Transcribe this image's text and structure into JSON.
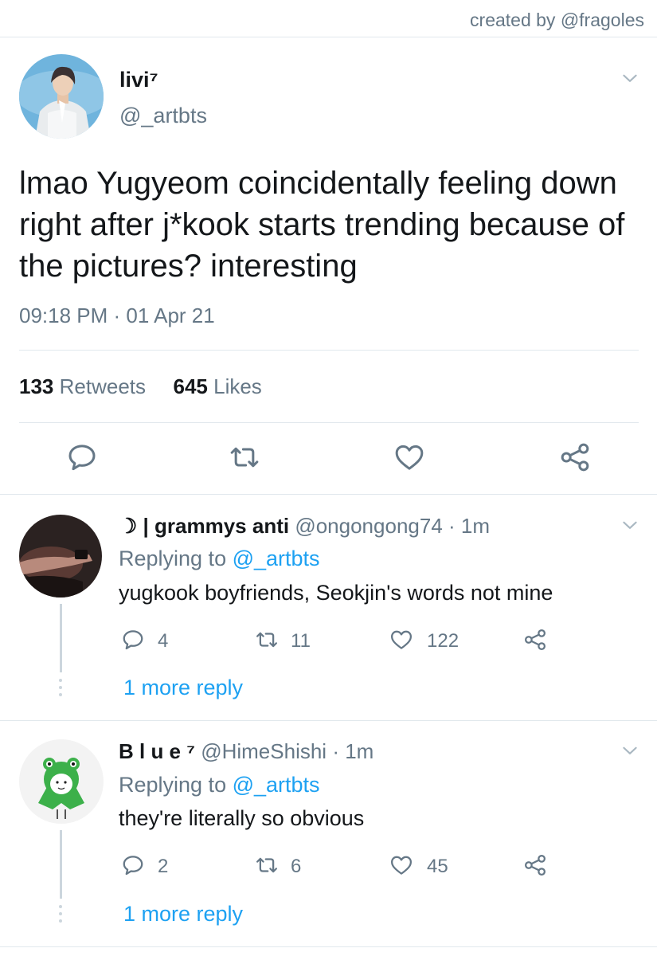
{
  "credit": "created by @fragoles",
  "main": {
    "name": "livi⁷",
    "handle": "@_artbts",
    "text": "lmao Yugyeom coincidentally feeling down right after j*kook starts trending because of the pictures? interesting",
    "timestamp": "09:18 PM · 01 Apr 21",
    "retweets_count": "133",
    "retweets_label": "Retweets",
    "likes_count": "645",
    "likes_label": "Likes"
  },
  "replies": [
    {
      "name": "☽ | grammys anti",
      "handle": "@ongongong74",
      "time": "· 1m",
      "replying_prefix": "Replying to",
      "replying_handle": "@_artbts",
      "text": "yugkook boyfriends, Seokjin's words not mine",
      "replies": "4",
      "retweets": "11",
      "likes": "122",
      "more": "1 more reply"
    },
    {
      "name": "B l u e ⁷",
      "handle": "@HimeShishi",
      "time": "· 1m",
      "replying_prefix": "Replying to",
      "replying_handle": "@_artbts",
      "text": "they're literally so obvious",
      "replies": "2",
      "retweets": "6",
      "likes": "45",
      "more": "1 more reply"
    }
  ],
  "icons": {
    "reply": "reply-icon",
    "retweet": "retweet-icon",
    "like": "heart-icon",
    "share": "share-icon",
    "menu": "chevron-down-icon"
  },
  "colors": {
    "link": "#1da1f2",
    "secondary_text": "#657786",
    "divider": "#e1e8ed"
  }
}
